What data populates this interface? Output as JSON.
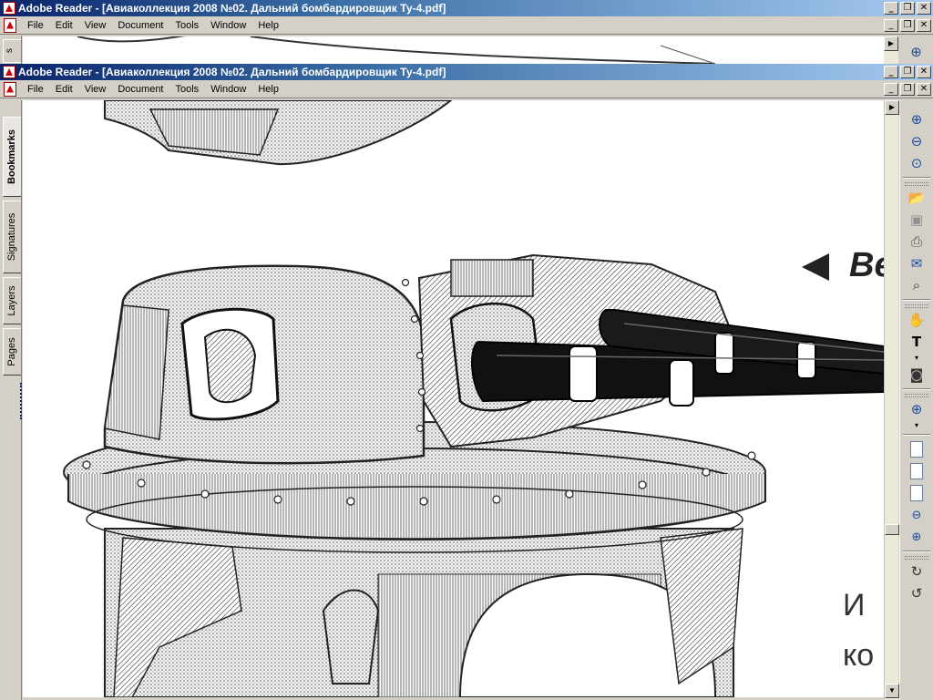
{
  "window": {
    "title": "Adobe Reader - [Авиаколлекция 2008 №02. Дальний бомбардировщик Ту-4.pdf]"
  },
  "menu": [
    "File",
    "Edit",
    "View",
    "Document",
    "Tools",
    "Window",
    "Help"
  ],
  "sidebar_tabs": [
    "Bookmarks",
    "Signatures",
    "Layers",
    "Pages"
  ],
  "background_sidebar_tab": "s",
  "page_content": {
    "headline": "Ве",
    "line1": "И",
    "line2": "ко"
  },
  "toolbar_icons": [
    "zoom-in-icon",
    "zoom-out-icon",
    "actual-size-icon",
    "open-folder-icon",
    "save-icon",
    "print-icon",
    "email-icon",
    "search-binoculars-icon",
    "hand-tool-icon",
    "select-text-icon",
    "snapshot-icon",
    "zoom-tool-icon",
    "single-page-icon",
    "continuous-page-icon",
    "facing-page-icon",
    "zoom-out-circle-icon",
    "zoom-in-circle-icon",
    "rotate-clockwise-icon",
    "rotate-counterclockwise-icon"
  ],
  "colors": {
    "titlebar_start": "#0a246a",
    "titlebar_end": "#a6caf0",
    "chrome": "#d4d0c8",
    "toolbar_icon": "#1c4ea0"
  }
}
